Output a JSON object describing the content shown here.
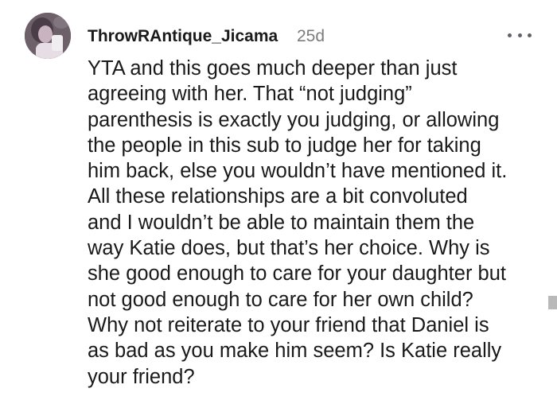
{
  "comment": {
    "author": "ThrowRAntique_Jicama",
    "age": "25d",
    "avatar_icon": "user-avatar-icon",
    "more_icon": "more-options-icon",
    "body_lines": [
      "YTA and this goes much deeper than just",
      "agreeing with her. That “not judging”",
      "parenthesis is exactly you judging, or allowing",
      "the people in this sub to judge her for taking",
      "him back, else you wouldn’t have mentioned it.",
      "All these relationships are a bit convoluted",
      "and I wouldn’t be able to maintain them the",
      "way Katie does, but that’s her choice. Why is",
      "she good enough to care for your daughter but",
      "not good enough to care for her own child?",
      "Why not reiterate to your friend that Daniel is",
      "as bad as you make him seem? Is Katie really",
      "your friend?"
    ]
  },
  "colors": {
    "text": "#1a1a1b",
    "muted": "#7c7c7c",
    "background": "#ffffff"
  }
}
